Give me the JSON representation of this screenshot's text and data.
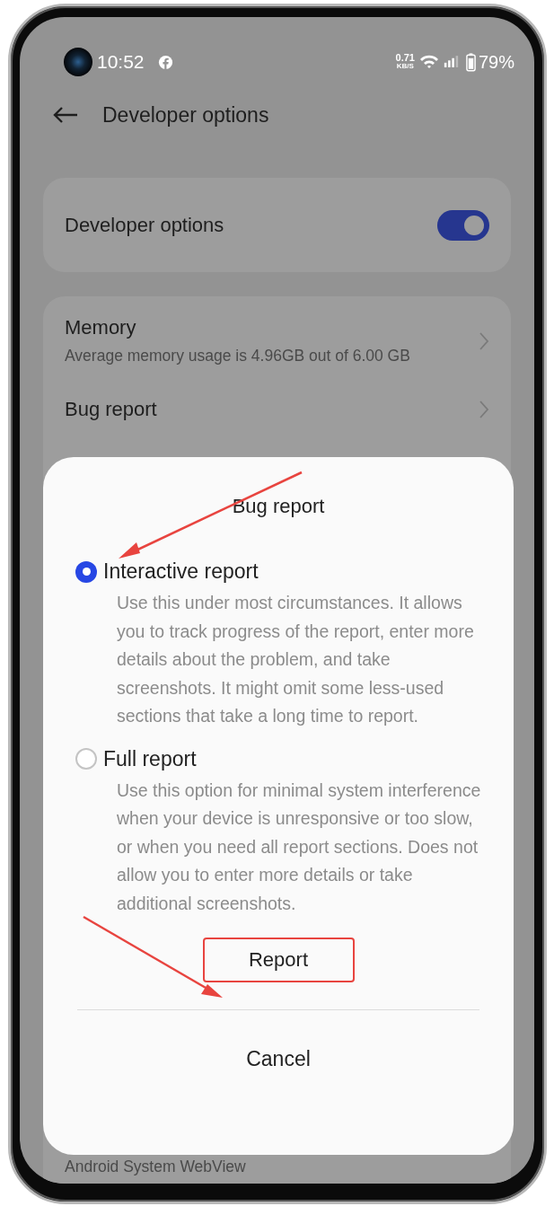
{
  "status_bar": {
    "time": "10:52",
    "net_speed": "0.71",
    "net_speed_unit": "KB/S",
    "battery": "79%"
  },
  "header": {
    "title": "Developer options"
  },
  "master_switch": {
    "label": "Developer options",
    "on": true
  },
  "settings": [
    {
      "title": "Memory",
      "subtitle": "Average memory usage is 4.96GB out of 6.00 GB"
    },
    {
      "title": "Bug report"
    }
  ],
  "bottom_text": "Android System WebView",
  "dialog": {
    "title": "Bug report",
    "options": [
      {
        "label": "Interactive report",
        "description": "Use this under most circumstances. It allows you to track progress of the report, enter more details about the problem, and take screenshots. It might omit some less-used sections that take a long time to report.",
        "selected": true
      },
      {
        "label": "Full report",
        "description": "Use this option for minimal system interference when your device is unresponsive or too slow, or when you need all report sections. Does not allow you to enter more details or take additional screenshots.",
        "selected": false
      }
    ],
    "confirm": "Report",
    "cancel": "Cancel"
  }
}
